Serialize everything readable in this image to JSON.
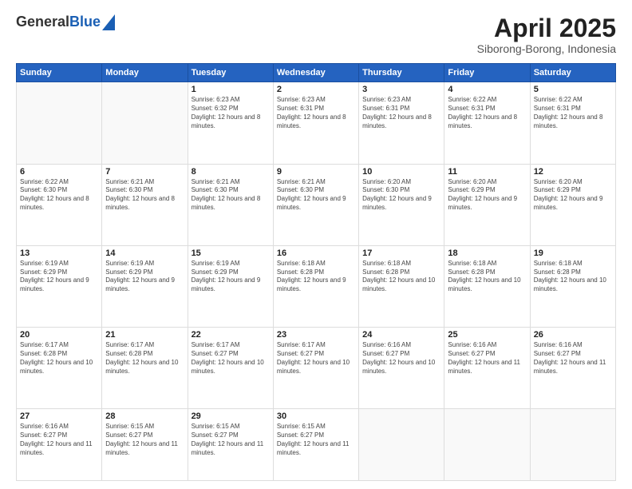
{
  "header": {
    "logo_line1": "General",
    "logo_line2": "Blue",
    "month": "April 2025",
    "location": "Siborong-Borong, Indonesia"
  },
  "weekdays": [
    "Sunday",
    "Monday",
    "Tuesday",
    "Wednesday",
    "Thursday",
    "Friday",
    "Saturday"
  ],
  "weeks": [
    [
      {
        "day": "",
        "info": ""
      },
      {
        "day": "",
        "info": ""
      },
      {
        "day": "1",
        "info": "Sunrise: 6:23 AM\nSunset: 6:32 PM\nDaylight: 12 hours and 8 minutes."
      },
      {
        "day": "2",
        "info": "Sunrise: 6:23 AM\nSunset: 6:31 PM\nDaylight: 12 hours and 8 minutes."
      },
      {
        "day": "3",
        "info": "Sunrise: 6:23 AM\nSunset: 6:31 PM\nDaylight: 12 hours and 8 minutes."
      },
      {
        "day": "4",
        "info": "Sunrise: 6:22 AM\nSunset: 6:31 PM\nDaylight: 12 hours and 8 minutes."
      },
      {
        "day": "5",
        "info": "Sunrise: 6:22 AM\nSunset: 6:31 PM\nDaylight: 12 hours and 8 minutes."
      }
    ],
    [
      {
        "day": "6",
        "info": "Sunrise: 6:22 AM\nSunset: 6:30 PM\nDaylight: 12 hours and 8 minutes."
      },
      {
        "day": "7",
        "info": "Sunrise: 6:21 AM\nSunset: 6:30 PM\nDaylight: 12 hours and 8 minutes."
      },
      {
        "day": "8",
        "info": "Sunrise: 6:21 AM\nSunset: 6:30 PM\nDaylight: 12 hours and 8 minutes."
      },
      {
        "day": "9",
        "info": "Sunrise: 6:21 AM\nSunset: 6:30 PM\nDaylight: 12 hours and 9 minutes."
      },
      {
        "day": "10",
        "info": "Sunrise: 6:20 AM\nSunset: 6:30 PM\nDaylight: 12 hours and 9 minutes."
      },
      {
        "day": "11",
        "info": "Sunrise: 6:20 AM\nSunset: 6:29 PM\nDaylight: 12 hours and 9 minutes."
      },
      {
        "day": "12",
        "info": "Sunrise: 6:20 AM\nSunset: 6:29 PM\nDaylight: 12 hours and 9 minutes."
      }
    ],
    [
      {
        "day": "13",
        "info": "Sunrise: 6:19 AM\nSunset: 6:29 PM\nDaylight: 12 hours and 9 minutes."
      },
      {
        "day": "14",
        "info": "Sunrise: 6:19 AM\nSunset: 6:29 PM\nDaylight: 12 hours and 9 minutes."
      },
      {
        "day": "15",
        "info": "Sunrise: 6:19 AM\nSunset: 6:29 PM\nDaylight: 12 hours and 9 minutes."
      },
      {
        "day": "16",
        "info": "Sunrise: 6:18 AM\nSunset: 6:28 PM\nDaylight: 12 hours and 9 minutes."
      },
      {
        "day": "17",
        "info": "Sunrise: 6:18 AM\nSunset: 6:28 PM\nDaylight: 12 hours and 10 minutes."
      },
      {
        "day": "18",
        "info": "Sunrise: 6:18 AM\nSunset: 6:28 PM\nDaylight: 12 hours and 10 minutes."
      },
      {
        "day": "19",
        "info": "Sunrise: 6:18 AM\nSunset: 6:28 PM\nDaylight: 12 hours and 10 minutes."
      }
    ],
    [
      {
        "day": "20",
        "info": "Sunrise: 6:17 AM\nSunset: 6:28 PM\nDaylight: 12 hours and 10 minutes."
      },
      {
        "day": "21",
        "info": "Sunrise: 6:17 AM\nSunset: 6:28 PM\nDaylight: 12 hours and 10 minutes."
      },
      {
        "day": "22",
        "info": "Sunrise: 6:17 AM\nSunset: 6:27 PM\nDaylight: 12 hours and 10 minutes."
      },
      {
        "day": "23",
        "info": "Sunrise: 6:17 AM\nSunset: 6:27 PM\nDaylight: 12 hours and 10 minutes."
      },
      {
        "day": "24",
        "info": "Sunrise: 6:16 AM\nSunset: 6:27 PM\nDaylight: 12 hours and 10 minutes."
      },
      {
        "day": "25",
        "info": "Sunrise: 6:16 AM\nSunset: 6:27 PM\nDaylight: 12 hours and 11 minutes."
      },
      {
        "day": "26",
        "info": "Sunrise: 6:16 AM\nSunset: 6:27 PM\nDaylight: 12 hours and 11 minutes."
      }
    ],
    [
      {
        "day": "27",
        "info": "Sunrise: 6:16 AM\nSunset: 6:27 PM\nDaylight: 12 hours and 11 minutes."
      },
      {
        "day": "28",
        "info": "Sunrise: 6:15 AM\nSunset: 6:27 PM\nDaylight: 12 hours and 11 minutes."
      },
      {
        "day": "29",
        "info": "Sunrise: 6:15 AM\nSunset: 6:27 PM\nDaylight: 12 hours and 11 minutes."
      },
      {
        "day": "30",
        "info": "Sunrise: 6:15 AM\nSunset: 6:27 PM\nDaylight: 12 hours and 11 minutes."
      },
      {
        "day": "",
        "info": ""
      },
      {
        "day": "",
        "info": ""
      },
      {
        "day": "",
        "info": ""
      }
    ]
  ]
}
